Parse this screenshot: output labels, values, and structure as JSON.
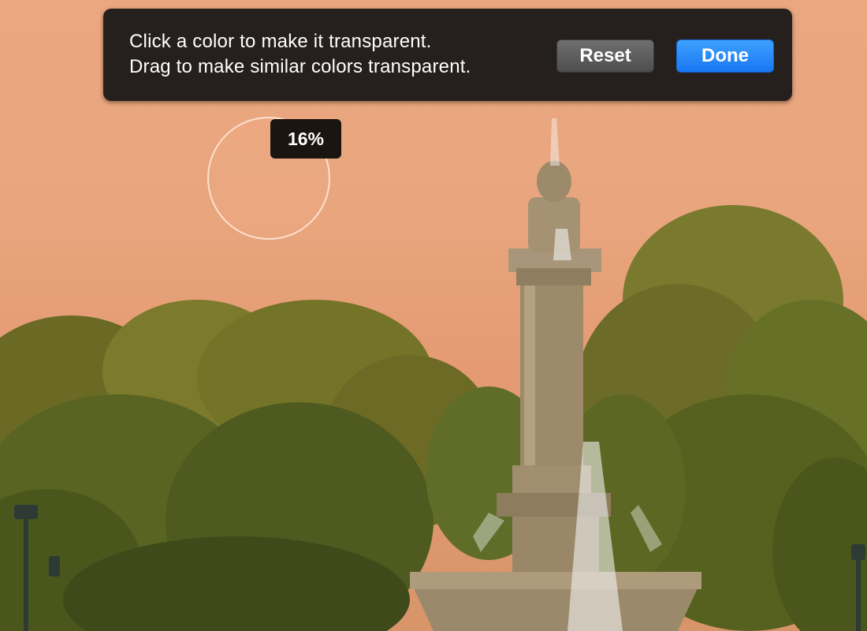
{
  "instructions": {
    "line1": "Click a color to make it transparent.",
    "line2": "Drag to make similar colors transparent."
  },
  "buttons": {
    "reset_label": "Reset",
    "done_label": "Done"
  },
  "tolerance": {
    "percent_label": "16%"
  },
  "colors": {
    "sky": "#e9a57d",
    "hud_bg": "#161616",
    "done_accent": "#1877f2",
    "stone": "#9d8a6a",
    "foliage": "#5f6d28"
  }
}
